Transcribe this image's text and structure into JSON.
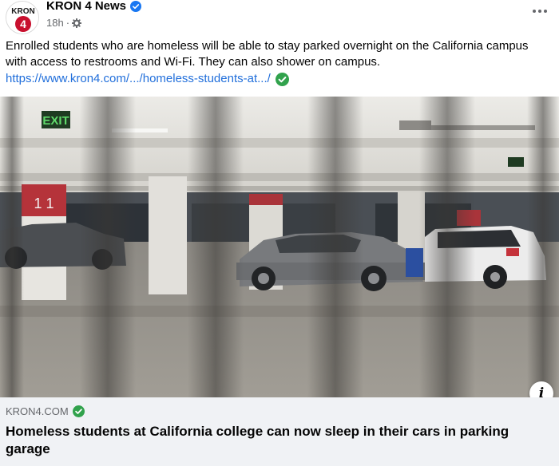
{
  "post": {
    "page_name": "KRON 4 News",
    "avatar_text": "KRON",
    "avatar_number": "4",
    "timestamp": "18h",
    "separator": "·",
    "caption": "Enrolled students who are homeless will be able to stay parked overnight on the California campus with access to restrooms and Wi-Fi. They can also shower on campus.",
    "link_text": "https://www.kron4.com/.../homeless-students-at.../"
  },
  "photo": {
    "exit_sign": "EXIT",
    "pillar_number": "1 1"
  },
  "preview": {
    "domain": "KRON4.COM",
    "headline": "Homeless students at California college can now sleep in their cars in parking garage",
    "info_label": "i"
  },
  "colors": {
    "link": "#216fdb",
    "verified": "#1877f2",
    "green_check": "#31a24c",
    "preview_bg": "#f0f2f5",
    "kron_red": "#c8102e"
  },
  "icons": [
    "kron4-logo-icon",
    "verified-badge-icon",
    "gear-icon",
    "more-options-icon",
    "check-circle-icon",
    "info-icon"
  ]
}
